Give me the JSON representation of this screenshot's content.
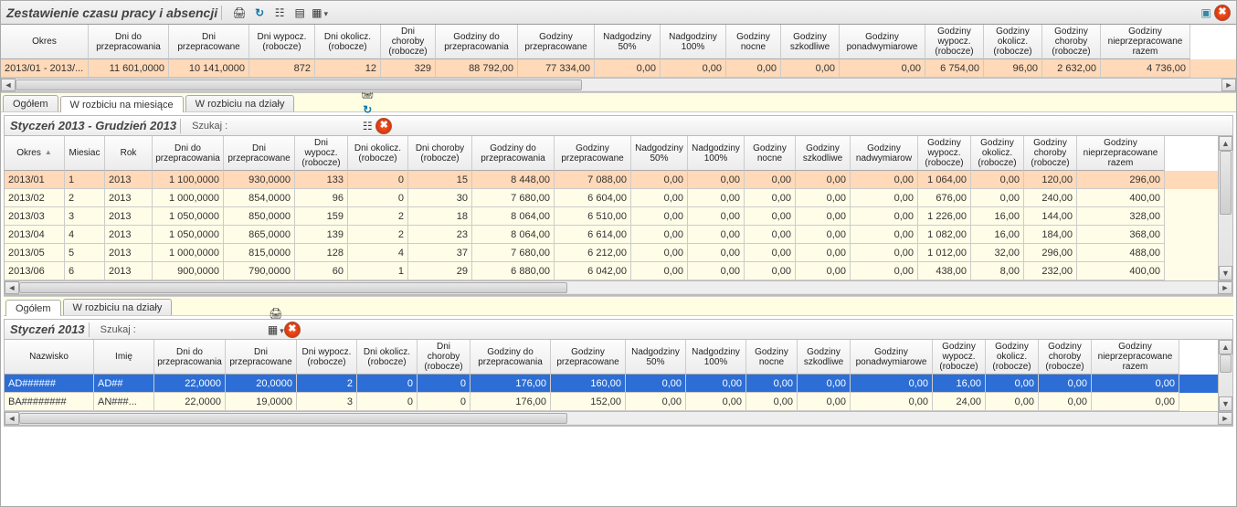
{
  "main": {
    "title": "Zestawienie czasu pracy i absencji",
    "tabs": [
      {
        "label": "Ogółem"
      },
      {
        "label": "W rozbiciu na miesiące"
      },
      {
        "label": "W rozbiciu na działy"
      }
    ],
    "active_tab": 1
  },
  "summary": {
    "columns": [
      {
        "label": "Okres",
        "w": 96
      },
      {
        "label": "Dni do\nprzepracowania",
        "w": 88
      },
      {
        "label": "Dni\nprzepracowane",
        "w": 88
      },
      {
        "label": "Dni wypocz.\n(robocze)",
        "w": 72
      },
      {
        "label": "Dni okolicz.\n(robocze)",
        "w": 72
      },
      {
        "label": "Dni\nchoroby\n(robocze)",
        "w": 60
      },
      {
        "label": "Godziny do\nprzepracowania",
        "w": 90
      },
      {
        "label": "Godziny\nprzepracowane",
        "w": 84
      },
      {
        "label": "Nadgodziny\n50%",
        "w": 72
      },
      {
        "label": "Nadgodziny\n100%",
        "w": 72
      },
      {
        "label": "Godziny\nnocne",
        "w": 60
      },
      {
        "label": "Godziny\nszkodliwe",
        "w": 64
      },
      {
        "label": "Godziny\nponadwymiarowe",
        "w": 94
      },
      {
        "label": "Godziny\nwypocz.\n(robocze)",
        "w": 64
      },
      {
        "label": "Godziny\nokolicz.\n(robocze)",
        "w": 64
      },
      {
        "label": "Godziny\nchoroby\n(robocze)",
        "w": 64
      },
      {
        "label": "Godziny\nnieprzepracowane\nrazem",
        "w": 98
      }
    ],
    "rows": [
      {
        "cls": "row-orange",
        "cells": [
          "2013/01 - 2013/...",
          "11 601,0000",
          "10 141,0000",
          "872",
          "12",
          "329",
          "88 792,00",
          "77 334,00",
          "0,00",
          "0,00",
          "0,00",
          "0,00",
          "0,00",
          "6 754,00",
          "96,00",
          "2 632,00",
          "4 736,00"
        ]
      }
    ]
  },
  "months": {
    "title": "Styczeń 2013 - Grudzień 2013",
    "search_label": "Szukaj  :",
    "columns": [
      {
        "label": "Okres",
        "w": 66,
        "sort": true
      },
      {
        "label": "Miesiac",
        "w": 44
      },
      {
        "label": "Rok",
        "w": 52
      },
      {
        "label": "Dni do\nprzepracowania",
        "w": 78
      },
      {
        "label": "Dni\nprzepracowane",
        "w": 78
      },
      {
        "label": "Dni\nwypocz.\n(robocze)",
        "w": 58
      },
      {
        "label": "Dni okolicz.\n(robocze)",
        "w": 66
      },
      {
        "label": "Dni choroby\n(robocze)",
        "w": 70
      },
      {
        "label": "Godziny do\nprzepracowania",
        "w": 90
      },
      {
        "label": "Godziny\nprzepracowane",
        "w": 84
      },
      {
        "label": "Nadgodziny\n50%",
        "w": 62
      },
      {
        "label": "Nadgodziny\n100%",
        "w": 62
      },
      {
        "label": "Godziny\nnocne",
        "w": 56
      },
      {
        "label": "Godziny\nszkodliwe",
        "w": 60
      },
      {
        "label": "Godziny\nnadwymiarow",
        "w": 74
      },
      {
        "label": "Godziny\nwypocz.\n(robocze)",
        "w": 58
      },
      {
        "label": "Godziny\nokolicz.\n(robocze)",
        "w": 58
      },
      {
        "label": "Godziny\nchoroby\n(robocze)",
        "w": 58
      },
      {
        "label": "Godziny\nnieprzepracowane\nrazem",
        "w": 96
      }
    ],
    "rows": [
      {
        "cls": "row-orange",
        "cells": [
          "2013/01",
          "1",
          "2013",
          "1 100,0000",
          "930,0000",
          "133",
          "0",
          "15",
          "8 448,00",
          "7 088,00",
          "0,00",
          "0,00",
          "0,00",
          "0,00",
          "0,00",
          "1 064,00",
          "0,00",
          "120,00",
          "296,00"
        ]
      },
      {
        "cls": "row-yellow",
        "cells": [
          "2013/02",
          "2",
          "2013",
          "1 000,0000",
          "854,0000",
          "96",
          "0",
          "30",
          "7 680,00",
          "6 604,00",
          "0,00",
          "0,00",
          "0,00",
          "0,00",
          "0,00",
          "676,00",
          "0,00",
          "240,00",
          "400,00"
        ]
      },
      {
        "cls": "row-yellow",
        "cells": [
          "2013/03",
          "3",
          "2013",
          "1 050,0000",
          "850,0000",
          "159",
          "2",
          "18",
          "8 064,00",
          "6 510,00",
          "0,00",
          "0,00",
          "0,00",
          "0,00",
          "0,00",
          "1 226,00",
          "16,00",
          "144,00",
          "328,00"
        ]
      },
      {
        "cls": "row-yellow",
        "cells": [
          "2013/04",
          "4",
          "2013",
          "1 050,0000",
          "865,0000",
          "139",
          "2",
          "23",
          "8 064,00",
          "6 614,00",
          "0,00",
          "0,00",
          "0,00",
          "0,00",
          "0,00",
          "1 082,00",
          "16,00",
          "184,00",
          "368,00"
        ]
      },
      {
        "cls": "row-yellow",
        "cells": [
          "2013/05",
          "5",
          "2013",
          "1 000,0000",
          "815,0000",
          "128",
          "4",
          "37",
          "7 680,00",
          "6 212,00",
          "0,00",
          "0,00",
          "0,00",
          "0,00",
          "0,00",
          "1 012,00",
          "32,00",
          "296,00",
          "488,00"
        ]
      },
      {
        "cls": "row-yellow",
        "cells": [
          "2013/06",
          "6",
          "2013",
          "900,0000",
          "790,0000",
          "60",
          "1",
          "29",
          "6 880,00",
          "6 042,00",
          "0,00",
          "0,00",
          "0,00",
          "0,00",
          "0,00",
          "438,00",
          "8,00",
          "232,00",
          "400,00"
        ]
      }
    ],
    "tabs": [
      {
        "label": "Ogółem"
      },
      {
        "label": "W rozbiciu na działy"
      }
    ],
    "active_tab": 0
  },
  "detail": {
    "title": "Styczeń 2013",
    "search_label": "Szukaj  :",
    "columns": [
      {
        "label": "Nazwisko",
        "w": 98
      },
      {
        "label": "Imię",
        "w": 66
      },
      {
        "label": "Dni do\nprzepracowania",
        "w": 78
      },
      {
        "label": "Dni\nprzepracowane",
        "w": 78
      },
      {
        "label": "Dni wypocz.\n(robocze)",
        "w": 66
      },
      {
        "label": "Dni okolicz.\n(robocze)",
        "w": 66
      },
      {
        "label": "Dni\nchoroby\n(robocze)",
        "w": 58
      },
      {
        "label": "Godziny do\nprzepracowania",
        "w": 88
      },
      {
        "label": "Godziny\nprzepracowane",
        "w": 82
      },
      {
        "label": "Nadgodziny\n50%",
        "w": 66
      },
      {
        "label": "Nadgodziny\n100%",
        "w": 66
      },
      {
        "label": "Godziny\nnocne",
        "w": 56
      },
      {
        "label": "Godziny\nszkodliwe",
        "w": 58
      },
      {
        "label": "Godziny\nponadwymiarowe",
        "w": 90
      },
      {
        "label": "Godziny\nwypocz.\n(robocze)",
        "w": 58
      },
      {
        "label": "Godziny\nokolicz.\n(robocze)",
        "w": 58
      },
      {
        "label": "Godziny\nchoroby\n(robocze)",
        "w": 58
      },
      {
        "label": "Godziny\nnieprzepracowane\nrazem",
        "w": 96
      }
    ],
    "rows": [
      {
        "cls": "row-blue",
        "cells": [
          "AD######",
          "AD##",
          "22,0000",
          "20,0000",
          "2",
          "0",
          "0",
          "176,00",
          "160,00",
          "0,00",
          "0,00",
          "0,00",
          "0,00",
          "0,00",
          "16,00",
          "0,00",
          "0,00",
          "0,00"
        ]
      },
      {
        "cls": "row-yellow",
        "cells": [
          "BA########",
          "AN###...",
          "22,0000",
          "19,0000",
          "3",
          "0",
          "0",
          "176,00",
          "152,00",
          "0,00",
          "0,00",
          "0,00",
          "0,00",
          "0,00",
          "24,00",
          "0,00",
          "0,00",
          "0,00"
        ]
      }
    ]
  },
  "icons": {
    "print": "print-icon",
    "refresh": "refresh-icon",
    "chart": "chart-icon",
    "columns": "columns-icon",
    "grid": "grid-icon",
    "copy": "copy-icon",
    "window": "window-icon",
    "close": "close-icon"
  }
}
